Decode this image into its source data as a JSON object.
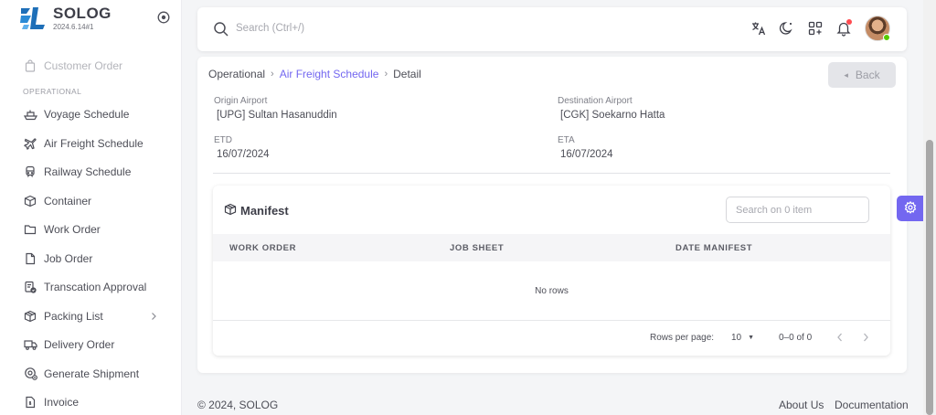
{
  "brand": {
    "name": "SOLOG",
    "version": "2024.6.14#1"
  },
  "colors": {
    "accent": "#7367f0",
    "online": "#56ca00",
    "notification": "#ff4c51"
  },
  "sidebar": {
    "top_item": {
      "label": "Customer Order",
      "icon": "bag-icon"
    },
    "section": "OPERATIONAL",
    "items": [
      {
        "label": "Voyage Schedule",
        "icon": "ship-icon"
      },
      {
        "label": "Air Freight Schedule",
        "icon": "plane-icon"
      },
      {
        "label": "Railway Schedule",
        "icon": "train-icon"
      },
      {
        "label": "Container",
        "icon": "box-icon"
      },
      {
        "label": "Work Order",
        "icon": "folder-icon"
      },
      {
        "label": "Job Order",
        "icon": "file-icon"
      },
      {
        "label": "Transcation Approval",
        "icon": "approval-icon"
      },
      {
        "label": "Packing List",
        "icon": "package-icon"
      },
      {
        "label": "Delivery Order",
        "icon": "truck-icon"
      },
      {
        "label": "Generate Shipment",
        "icon": "cog-icon"
      },
      {
        "label": "Invoice",
        "icon": "invoice-icon"
      }
    ]
  },
  "header": {
    "search_placeholder": "Search (Ctrl+/)"
  },
  "breadcrumb": {
    "root": "Operational",
    "parent": "Air Freight Schedule",
    "current": "Detail"
  },
  "back_label": "Back",
  "details": {
    "origin_label": "Origin Airport",
    "origin_value": "[UPG] Sultan Hasanuddin",
    "destination_label": "Destination Airport",
    "destination_value": "[CGK] Soekarno Hatta",
    "etd_label": "ETD",
    "etd_value": "16/07/2024",
    "eta_label": "ETA",
    "eta_value": "16/07/2024"
  },
  "manifest": {
    "title": "Manifest",
    "search_placeholder": "Search on 0 item",
    "columns": [
      "WORK ORDER",
      "JOB SHEET",
      "DATE MANIFEST"
    ],
    "empty_text": "No rows",
    "rows_per_page_label": "Rows per page:",
    "rows_per_page_value": "10",
    "range_text": "0–0 of 0"
  },
  "footer": {
    "copyright": "© 2024, SOLOG",
    "links": [
      "About Us",
      "Documentation"
    ]
  }
}
